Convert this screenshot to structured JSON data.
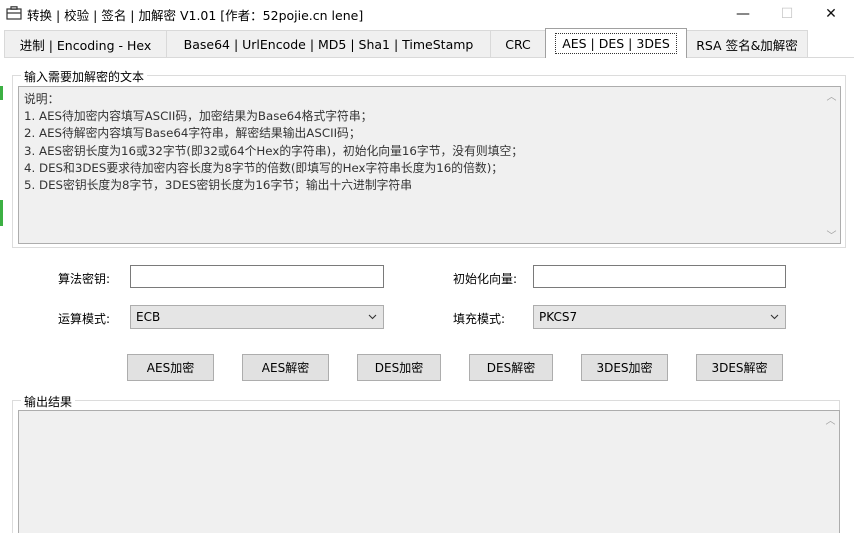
{
  "window": {
    "title": "转换 | 校验 | 签名 | 加解密 V1.01    [作者：52pojie.cn lene]",
    "minimize_symbol": "—",
    "maximize_symbol": "☐",
    "close_symbol": "✕"
  },
  "tabs": [
    {
      "label": "进制  |  Encoding - Hex",
      "active": false
    },
    {
      "label": "Base64  |  UrlEncode  |  MD5  |  Sha1  |  TimeStamp",
      "active": false
    },
    {
      "label": "CRC",
      "active": false
    },
    {
      "label": "AES  |  DES  |  3DES",
      "active": true
    },
    {
      "label": "RSA 签名&加解密",
      "active": false
    }
  ],
  "input_group": {
    "label": "输入需要加解密的文本",
    "lines": [
      "说明：",
      "1. AES待加密内容填写ASCII码，加密结果为Base64格式字符串；",
      "2. AES待解密内容填写Base64字符串，解密结果输出ASCII码；",
      "3. AES密钥长度为16或32字节(即32或64个Hex的字符串)，初始化向量16字节，没有则填空；",
      "4. DES和3DES要求待加密内容长度为8字节的倍数(即填写的Hex字符串长度为16的倍数)；",
      "5. DES密钥长度为8字节，3DES密钥长度为16字节；输出十六进制字符串"
    ]
  },
  "params": {
    "key_label": "算法密钥:",
    "key_value": "",
    "iv_label": "初始化向量:",
    "iv_value": "",
    "mode_label": "运算模式:",
    "mode_value": "ECB",
    "padding_label": "填充模式:",
    "padding_value": "PKCS7"
  },
  "buttons": {
    "aes_encrypt": "AES加密",
    "aes_decrypt": "AES解密",
    "des_encrypt": "DES加密",
    "des_decrypt": "DES解密",
    "tdes_encrypt": "3DES加密",
    "tdes_decrypt": "3DES解密"
  },
  "output_group": {
    "label": "输出结果",
    "value": ""
  },
  "colors": {
    "window_bg": "#ffffff",
    "tab_inactive_bg": "#f0f0f0",
    "button_bg": "#e1e1e1",
    "readonly_bg": "#f0f0f0",
    "side_marker": "#3cb043"
  }
}
